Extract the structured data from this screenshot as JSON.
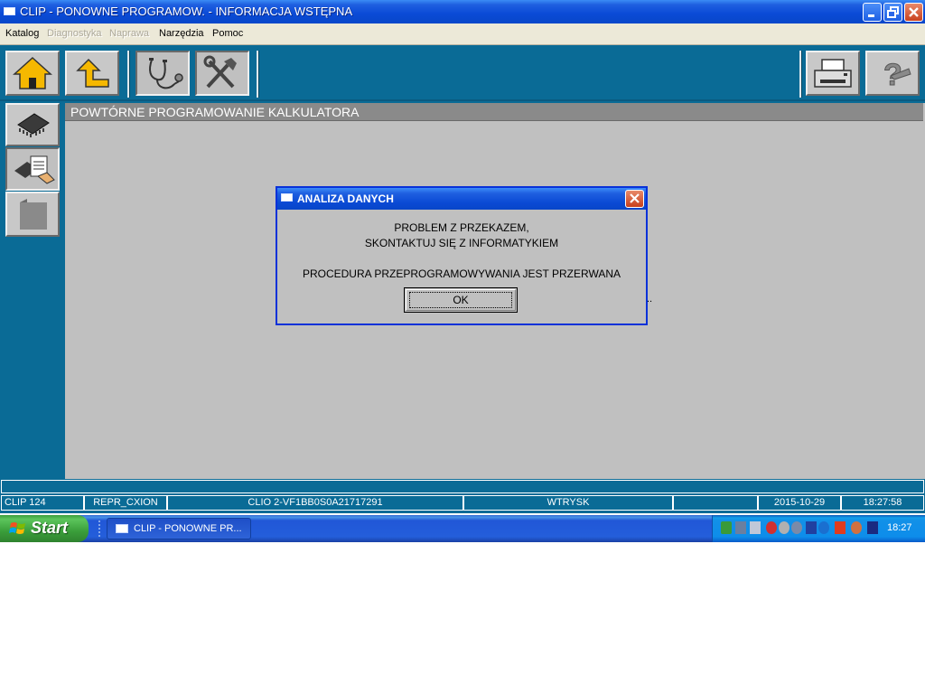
{
  "window": {
    "title": "CLIP - PONOWNE PROGRAMOW. - INFORMACJA WSTĘPNA"
  },
  "menu": {
    "items": [
      {
        "label": "Katalog",
        "enabled": true
      },
      {
        "label": "Diagnostyka",
        "enabled": false
      },
      {
        "label": "Naprawa",
        "enabled": false
      },
      {
        "label": "Narzędzia",
        "enabled": true
      },
      {
        "label": "Pomoc",
        "enabled": true
      }
    ]
  },
  "toolbar": {
    "icons": [
      "home-icon",
      "back-arrow-icon",
      "stethoscope-icon",
      "tools-icon",
      "printer-icon",
      "help-icon"
    ]
  },
  "sidebar": {
    "icons": [
      "ecu-chip-icon",
      "ecu-programming-icon",
      "document-icon"
    ]
  },
  "content": {
    "title": "POWTÓRNE PROGRAMOWANIE KALKULATORA",
    "trailing_text": ".."
  },
  "dialog": {
    "title": "ANALIZA DANYCH",
    "line1": "PROBLEM Z PRZEKAZEM,",
    "line2": "SKONTAKTUJ SIĘ Z INFORMATYKIEM",
    "line3": "PROCEDURA PRZEPROGRAMOWYWANIA JEST PRZERWANA",
    "ok_label": "OK"
  },
  "status": {
    "cells": [
      "CLIP 124",
      "REPR_CXION",
      "CLIO 2-VF1BB0S0A21717291",
      "WTRYSK",
      "",
      "2015-10-29",
      "18:27:58"
    ]
  },
  "taskbar": {
    "start_label": "Start",
    "task_label": "CLIP - PONOWNE PR...",
    "clock": "18:27"
  },
  "colors": {
    "app_background": "#0a6b96",
    "content_background": "#c0c0c0",
    "title_bar": "#0a4ad6"
  }
}
